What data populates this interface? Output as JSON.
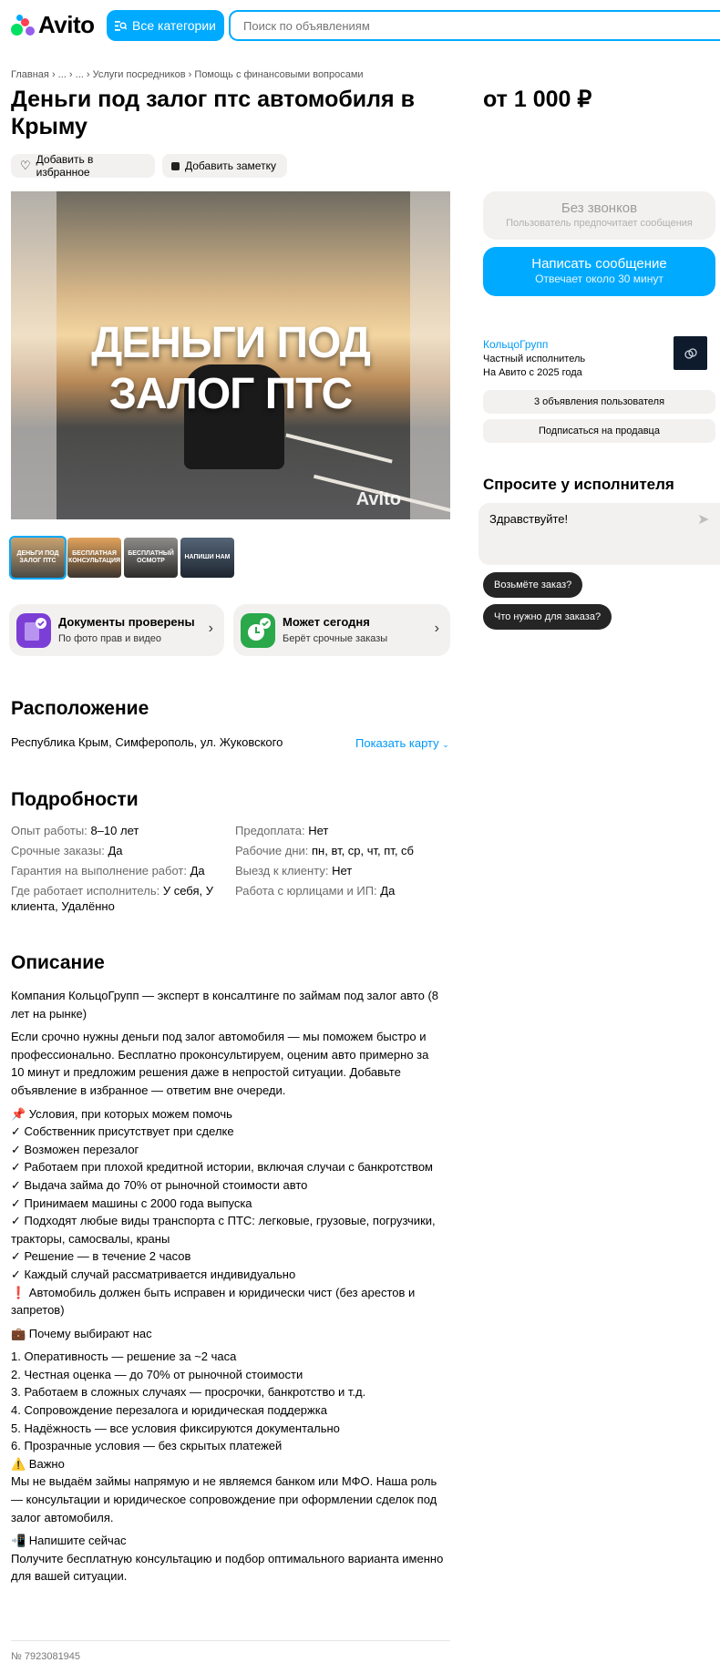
{
  "header": {
    "logo_text": "Avito",
    "categories_label": "Все категории",
    "search_placeholder": "Поиск по объявлениям"
  },
  "breadcrumb": [
    "Главная",
    "...",
    "...",
    "Услуги посредников",
    "Помощь с финансовыми вопросами"
  ],
  "title": "Деньги под залог птс автомобиля в Крыму",
  "price": "от 1 000 ₽",
  "actions": {
    "favorite": "Добавить в избранное",
    "note": "Добавить заметку"
  },
  "gallery": {
    "main_text_line1": "ДЕНЬГИ ПОД",
    "main_text_line2": "ЗАЛОГ ПТС",
    "watermark": "Avito",
    "thumbs": [
      "ДЕНЬГИ ПОД ЗАЛОГ ПТС",
      "БЕСПЛАТНАЯ КОНСУЛЬТАЦИЯ",
      "БЕСПЛАТНЫЙ ОСМОТР",
      "НАПИШИ НАМ"
    ]
  },
  "badges": [
    {
      "title": "Документы проверены",
      "subtitle": "По фото прав и видео",
      "color": "#7b3fd6"
    },
    {
      "title": "Может сегодня",
      "subtitle": "Берёт срочные заказы",
      "color": "#2aa84a"
    }
  ],
  "location": {
    "heading": "Расположение",
    "address": "Республика Крым, Симферополь, ул. Жуковского",
    "show_map": "Показать карту"
  },
  "details": {
    "heading": "Подробности",
    "items": [
      {
        "k": "Опыт работы:",
        "v": "8–10 лет"
      },
      {
        "k": "Предоплата:",
        "v": "Нет"
      },
      {
        "k": "Срочные заказы:",
        "v": "Да"
      },
      {
        "k": "Рабочие дни:",
        "v": "пн, вт, ср, чт, пт, сб"
      },
      {
        "k": "Гарантия на выполнение работ:",
        "v": "Да"
      },
      {
        "k": "Выезд к клиенту:",
        "v": "Нет"
      },
      {
        "k": "Где работает исполнитель:",
        "v": "У себя, У клиента, Удалённо"
      },
      {
        "k": "Работа с юрлицами и ИП:",
        "v": "Да"
      }
    ]
  },
  "description": {
    "heading": "Описание",
    "lines": [
      "Компания КольцоГрупп — эксперт в консалтинге по займам под залог авто (8 лет на рынке)",
      "",
      "Если срочно нужны деньги под залог автомобиля — мы поможем быстро и профессионально. Бесплатно проконсультируем, оценим авто примерно за 10 минут и предложим решения даже в непростой ситуации. Добавьте объявление в избранное — ответим вне очереди.",
      "",
      "📌 Условия, при которых можем помочь",
      "✓ Собственник присутствует при сделке",
      "✓ Возможен перезалог",
      "✓ Работаем при плохой кредитной истории, включая случаи с банкротством",
      "✓ Выдача займа до 70% от рыночной стоимости авто",
      "✓ Принимаем машины с 2000 года выпуска",
      "✓ Подходят любые виды транспорта с ПТС: легковые, грузовые, погрузчики, тракторы, самосвалы, краны",
      "✓ Решение — в течение 2 часов",
      "✓ Каждый случай рассматривается индивидуально",
      "❗ Автомобиль должен быть исправен и юридически чист (без арестов и запретов)",
      "",
      "💼 Почему выбирают нас",
      "",
      "1. Оперативность — решение за ~2 часа",
      "2. Честная оценка — до 70% от рыночной стоимости",
      "3. Работаем в сложных случаях — просрочки, банкротство и т.д.",
      "4. Сопровождение перезалога и юридическая поддержка",
      "5. Надёжность — все условия фиксируются документально",
      "6. Прозрачные условия — без скрытых платежей",
      "⚠️ Важно",
      "Мы не выдаём займы напрямую и не являемся банком или МФО. Наша роль — консультации и юридическое сопровождение при оформлении сделок под залог автомобиля.",
      "",
      "📲 Напишите сейчас",
      "Получите бесплатную консультацию и подбор оптимального варианта именно для вашей ситуации."
    ]
  },
  "item_number": "№ 7923081945",
  "contact": {
    "no_calls": "Без звонков",
    "no_calls_sub": "Пользователь предпочитает сообщения",
    "write": "Написать сообщение",
    "write_sub": "Отвечает около 30 минут"
  },
  "seller": {
    "name": "КольцоГрупп",
    "type": "Частный исполнитель",
    "since": "На Авито с 2025 года",
    "listings": "3 объявления пользователя",
    "subscribe": "Подписаться на продавца"
  },
  "ask": {
    "title": "Спросите у исполнителя",
    "message": "Здравствуйте!",
    "chips": [
      "Возьмёте заказ?",
      "Что нужно для заказа?"
    ]
  }
}
